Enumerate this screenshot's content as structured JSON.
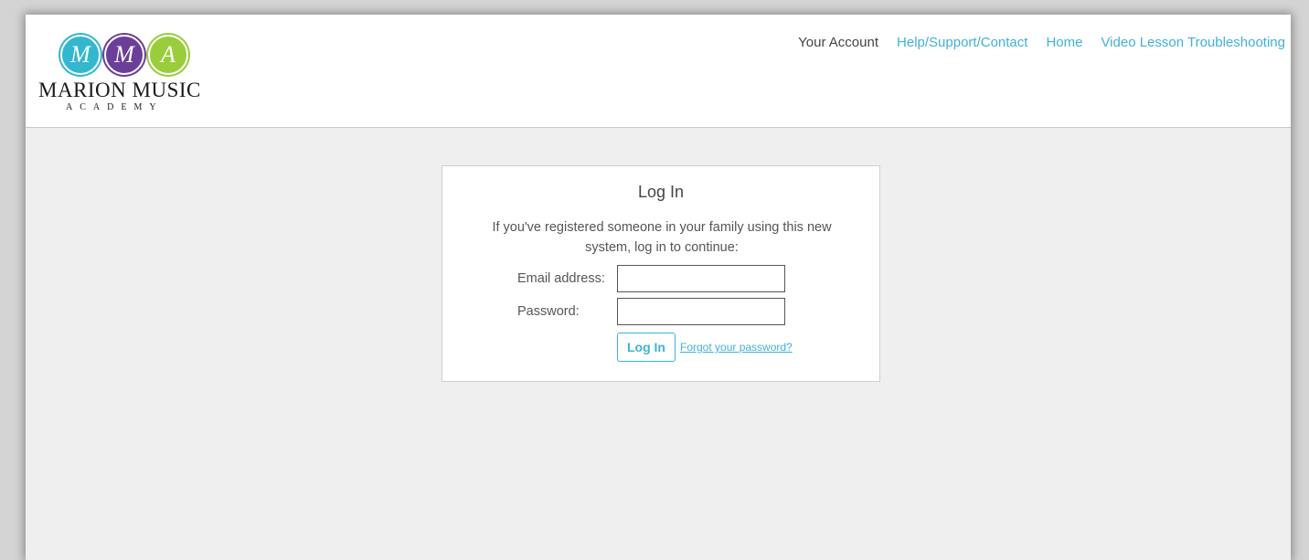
{
  "header": {
    "logo": {
      "letters": [
        "M",
        "M",
        "A"
      ],
      "name": "MARION MUSIC",
      "subtitle": "ACADEMY"
    },
    "nav": [
      {
        "label": "Your Account",
        "current": true
      },
      {
        "label": "Help/Support/Contact",
        "current": false
      },
      {
        "label": "Home",
        "current": false
      },
      {
        "label": "Video Lesson Troubleshooting",
        "current": false
      }
    ]
  },
  "login": {
    "title": "Log In",
    "description": "If you've registered someone in your family using this new system, log in to continue:",
    "email_label": "Email address:",
    "email_value": "",
    "password_label": "Password:",
    "password_value": "",
    "button_label": "Log In",
    "forgot_label": "Forgot your password?"
  },
  "colors": {
    "accent": "#3fb2d6",
    "logo_teal": "#33b7cf",
    "logo_purple": "#6b3f99",
    "logo_green": "#9acd3c",
    "background": "#efefef"
  }
}
